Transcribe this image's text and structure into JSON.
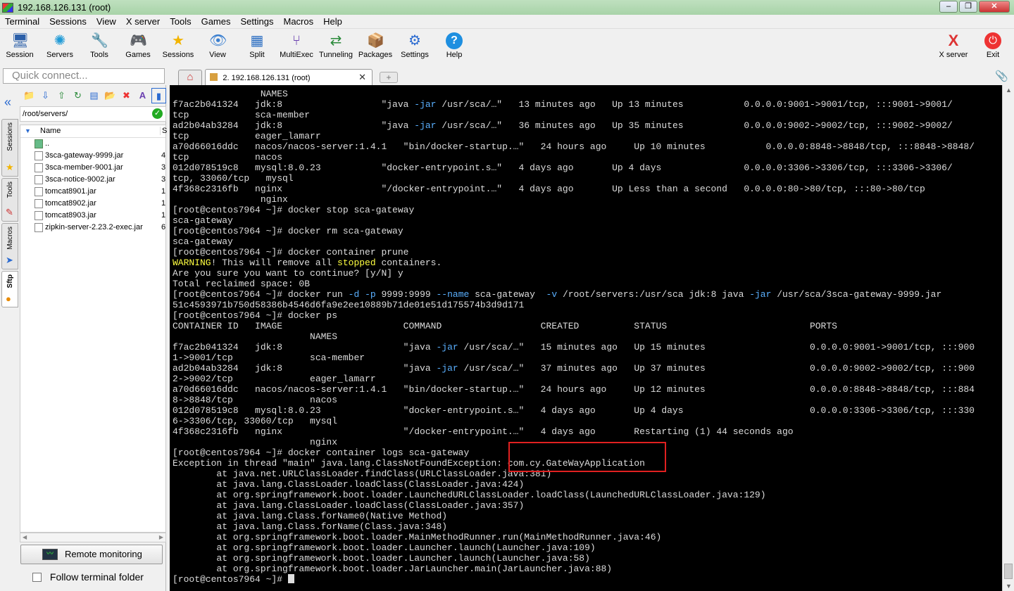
{
  "window": {
    "title": "192.168.126.131 (root)"
  },
  "menu": [
    "Terminal",
    "Sessions",
    "View",
    "X server",
    "Tools",
    "Games",
    "Settings",
    "Macros",
    "Help"
  ],
  "toolbar": {
    "items": [
      {
        "label": "Session",
        "icon": "session-icon",
        "glyph": "🖥"
      },
      {
        "label": "Servers",
        "icon": "servers-icon",
        "glyph": "✺"
      },
      {
        "label": "Tools",
        "icon": "tools-icon",
        "glyph": "🔧"
      },
      {
        "label": "Games",
        "icon": "games-icon",
        "glyph": "🎮"
      },
      {
        "label": "Sessions",
        "icon": "star-icon",
        "glyph": "★"
      },
      {
        "label": "View",
        "icon": "view-icon",
        "glyph": "👁"
      },
      {
        "label": "Split",
        "icon": "split-icon",
        "glyph": "▦"
      },
      {
        "label": "MultiExec",
        "icon": "multiexec-icon",
        "glyph": "⑂"
      },
      {
        "label": "Tunneling",
        "icon": "tunneling-icon",
        "glyph": "⇄"
      },
      {
        "label": "Packages",
        "icon": "packages-icon",
        "glyph": "📦"
      },
      {
        "label": "Settings",
        "icon": "settings-icon",
        "glyph": "⚙"
      },
      {
        "label": "Help",
        "icon": "help-icon",
        "glyph": "?"
      }
    ],
    "right": [
      {
        "label": "X server",
        "icon": "xserver-icon",
        "glyph": "X"
      },
      {
        "label": "Exit",
        "icon": "exit-icon",
        "glyph": "⏻"
      }
    ]
  },
  "quick_connect": {
    "placeholder": "Quick connect..."
  },
  "tabs": {
    "home_icon": "home-icon",
    "active_label": "2. 192.168.126.131 (root)",
    "close_glyph": "✕"
  },
  "side_tabs": [
    "Sessions",
    "Tools",
    "Macros",
    "Sftp"
  ],
  "sftp": {
    "path": "/root/servers/",
    "columns": {
      "name": "Name",
      "size": "S"
    },
    "files": [
      {
        "name": "..",
        "size": "",
        "type": "folder"
      },
      {
        "name": "3sca-gateway-9999.jar",
        "size": "4",
        "type": "file"
      },
      {
        "name": "3sca-member-9001.jar",
        "size": "3",
        "type": "file"
      },
      {
        "name": "3sca-notice-9002.jar",
        "size": "3",
        "type": "file"
      },
      {
        "name": "tomcat8901.jar",
        "size": "1",
        "type": "file"
      },
      {
        "name": "tomcat8902.jar",
        "size": "1",
        "type": "file"
      },
      {
        "name": "tomcat8903.jar",
        "size": "1",
        "type": "file"
      },
      {
        "name": "zipkin-server-2.23.2-exec.jar",
        "size": "6",
        "type": "file"
      }
    ],
    "remote_monitoring": "Remote monitoring",
    "follow_terminal": "Follow terminal folder"
  },
  "terminal": {
    "lines": [
      "                NAMES",
      "f7ac2b041324   jdk:8                  \"java -jar /usr/sca/…\"   13 minutes ago   Up 13 minutes           0.0.0.0:9001->9001/tcp, :::9001->9001/",
      "tcp            sca-member",
      "ad2b04ab3284   jdk:8                  \"java -jar /usr/sca/…\"   36 minutes ago   Up 35 minutes           0.0.0.0:9002->9002/tcp, :::9002->9002/",
      "tcp            eager_lamarr",
      "a70d66016ddc   nacos/nacos-server:1.4.1   \"bin/docker-startup.…\"   24 hours ago     Up 10 minutes           0.0.0.0:8848->8848/tcp, :::8848->8848/",
      "tcp            nacos",
      "012d078519c8   mysql:8.0.23           \"docker-entrypoint.s…\"   4 days ago       Up 4 days               0.0.0.0:3306->3306/tcp, :::3306->3306/",
      "tcp, 33060/tcp   mysql",
      "4f368c2316fb   nginx                  \"/docker-entrypoint.…\"   4 days ago       Up Less than a second   0.0.0.0:80->80/tcp, :::80->80/tcp",
      "                nginx",
      "[root@centos7964 ~]# docker stop sca-gateway",
      "sca-gateway",
      "[root@centos7964 ~]# docker rm sca-gateway",
      "sca-gateway",
      "[root@centos7964 ~]# docker container prune",
      "WARNING! This will remove all stopped containers.",
      "Are you sure you want to continue? [y/N] y",
      "Total reclaimed space: 0B",
      "[root@centos7964 ~]# docker run -d -p 9999:9999 --name sca-gateway  -v /root/servers:/usr/sca jdk:8 java -jar /usr/sca/3sca-gateway-9999.jar",
      "51c4593971b750d58386b4546d6fa9e2ee10889b71de01e51d175574b3d9d171",
      "[root@centos7964 ~]# docker ps",
      "CONTAINER ID   IMAGE                      COMMAND                  CREATED          STATUS                          PORTS",
      "                         NAMES",
      "f7ac2b041324   jdk:8                      \"java -jar /usr/sca/…\"   15 minutes ago   Up 15 minutes                   0.0.0.0:9001->9001/tcp, :::900",
      "1->9001/tcp              sca-member",
      "ad2b04ab3284   jdk:8                      \"java -jar /usr/sca/…\"   37 minutes ago   Up 37 minutes                   0.0.0.0:9002->9002/tcp, :::900",
      "2->9002/tcp              eager_lamarr",
      "a70d66016ddc   nacos/nacos-server:1.4.1   \"bin/docker-startup.…\"   24 hours ago     Up 12 minutes                   0.0.0.0:8848->8848/tcp, :::884",
      "8->8848/tcp              nacos",
      "012d078519c8   mysql:8.0.23               \"docker-entrypoint.s…\"   4 days ago       Up 4 days                       0.0.0.0:3306->3306/tcp, :::330",
      "6->3306/tcp, 33060/tcp   mysql",
      "4f368c2316fb   nginx                      \"/docker-entrypoint.…\"   4 days ago       Restarting (1) 44 seconds ago",
      "                         nginx",
      "[root@centos7964 ~]# docker container logs sca-gateway",
      "Exception in thread \"main\" java.lang.ClassNotFoundException: com.cy.GateWayApplication",
      "        at java.net.URLClassLoader.findClass(URLClassLoader.java:381)",
      "        at java.lang.ClassLoader.loadClass(ClassLoader.java:424)",
      "        at org.springframework.boot.loader.LaunchedURLClassLoader.loadClass(LaunchedURLClassLoader.java:129)",
      "        at java.lang.ClassLoader.loadClass(ClassLoader.java:357)",
      "        at java.lang.Class.forName0(Native Method)",
      "        at java.lang.Class.forName(Class.java:348)",
      "        at org.springframework.boot.loader.MainMethodRunner.run(MainMethodRunner.java:46)",
      "        at org.springframework.boot.loader.Launcher.launch(Launcher.java:109)",
      "        at org.springframework.boot.loader.Launcher.launch(Launcher.java:58)",
      "        at org.springframework.boot.loader.JarLauncher.main(JarLauncher.java:88)",
      "[root@centos7964 ~]# "
    ],
    "highlight_color": "#e02020"
  }
}
